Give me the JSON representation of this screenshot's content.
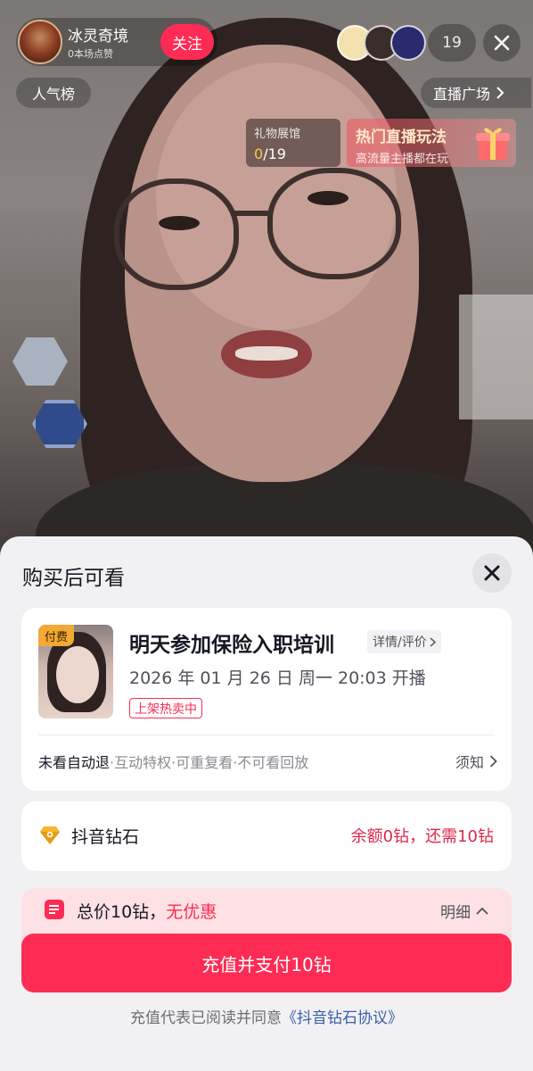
{
  "live": {
    "anchor_name": "冰灵奇境",
    "anchor_sub": "0本场点赞",
    "follow_label": "关注",
    "viewer_count": "19",
    "rank_label": "人气榜",
    "plaza_label": "直播广场",
    "gift_hall": {
      "title": "礼物展馆",
      "current": "0",
      "total": "/19"
    },
    "hot_banner": {
      "title": "热门直播玩法",
      "subtitle": "高流量主播都在玩"
    }
  },
  "sheet": {
    "title": "购买后可看",
    "product": {
      "badge": "付费",
      "title": "明天参加保险入职培训",
      "detail_link": "详情/评价",
      "time": "2026 年 01 月 26 日 周一 20:03 开播",
      "tag": "上架热卖中",
      "rule_strong": "未看自动退",
      "rule_rest": "·互动特权·可重复看·不可看回放",
      "notice": "须知"
    },
    "payment": {
      "method": "抖音钻石",
      "balance_text": "余额0钻，还需10钻"
    },
    "total": {
      "prefix": "总价10钻，",
      "discount": "无优惠",
      "detail_label": "明细"
    },
    "pay_button": "充值并支付10钻",
    "agreement_prefix": "充值代表已阅读并同意",
    "agreement_link": "《抖音钻石协议》"
  },
  "colors": {
    "brand": "#fe2c55",
    "price_text": "#e0264c",
    "paid_badge": "#f3a935",
    "link": "#3a5fa6",
    "sheet_bg": "#f1f1f4"
  },
  "icons": [
    "close-icon",
    "chevron-right-icon",
    "diamond-icon",
    "receipt-icon",
    "chevron-up-icon",
    "gift-box-icon"
  ]
}
